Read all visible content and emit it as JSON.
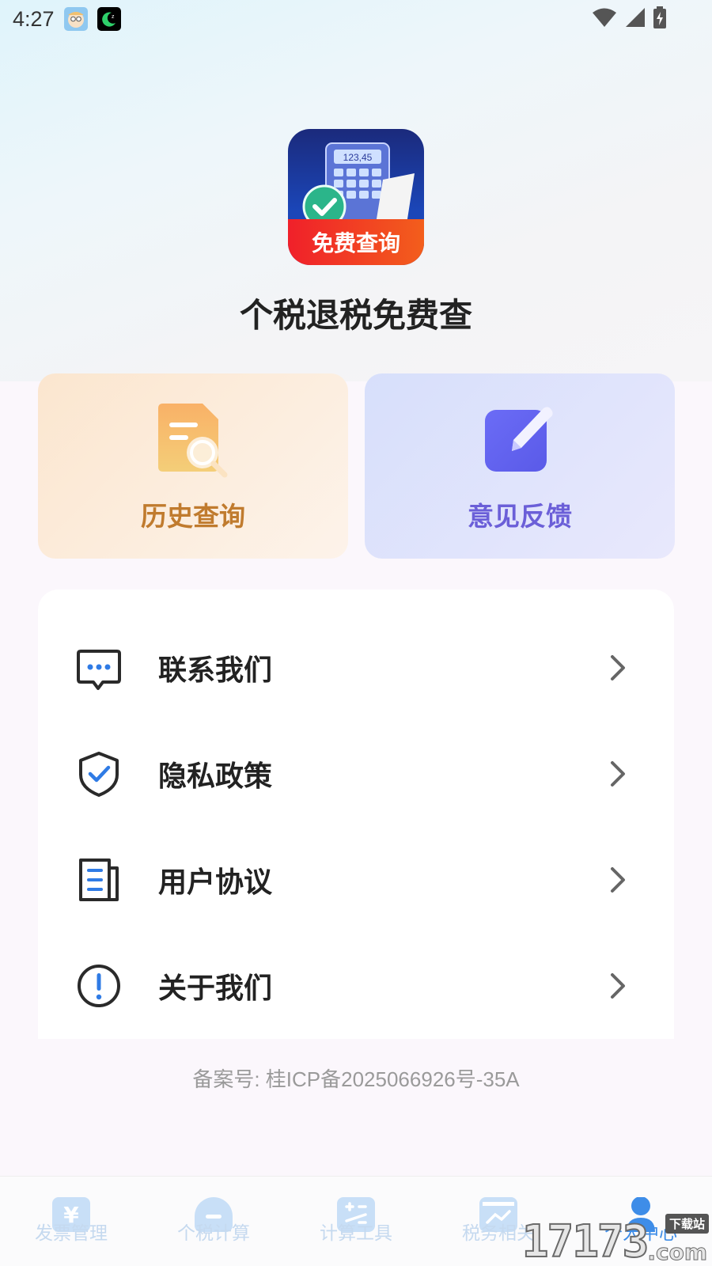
{
  "status_bar": {
    "time": "4:27",
    "notification_icons": [
      "baby-face-app-icon",
      "moon-sleep-app-icon"
    ],
    "system_icons": [
      "wifi-icon",
      "cell-signal-icon",
      "battery-charging-icon"
    ]
  },
  "app": {
    "logo_banner_text": "免费查询",
    "logo_display_number": "123,45",
    "name": "个税退税免费查"
  },
  "cards": {
    "history": {
      "label": "历史查询",
      "icon": "document-search-icon",
      "color": "#c07b2e"
    },
    "feedback": {
      "label": "意见反馈",
      "icon": "edit-note-icon",
      "color": "#6b5fd8"
    }
  },
  "menu": {
    "items": [
      {
        "label": "联系我们",
        "icon": "chat-bubble-icon"
      },
      {
        "label": "隐私政策",
        "icon": "shield-check-icon"
      },
      {
        "label": "用户协议",
        "icon": "document-list-icon"
      },
      {
        "label": "关于我们",
        "icon": "info-exclamation-icon"
      }
    ],
    "accent_color": "#2f7be5"
  },
  "footer": {
    "icp": "备案号: 桂ICP备2025066926号-35A"
  },
  "tabbar": {
    "tabs": [
      {
        "label": "发票管理",
        "icon": "invoice-yen-icon",
        "active": false
      },
      {
        "label": "个税计算",
        "icon": "tax-calc-icon",
        "active": false
      },
      {
        "label": "计算工具",
        "icon": "calculator-icon",
        "active": false
      },
      {
        "label": "税务相关",
        "icon": "tax-chart-icon",
        "active": false
      },
      {
        "label": "个人中心",
        "icon": "profile-icon",
        "active": true
      }
    ],
    "active_color": "#3e8de8",
    "inactive_color": "#c5d9ef"
  },
  "watermark": {
    "number": "17173",
    "suffix": ".com",
    "tag": "下载站"
  }
}
